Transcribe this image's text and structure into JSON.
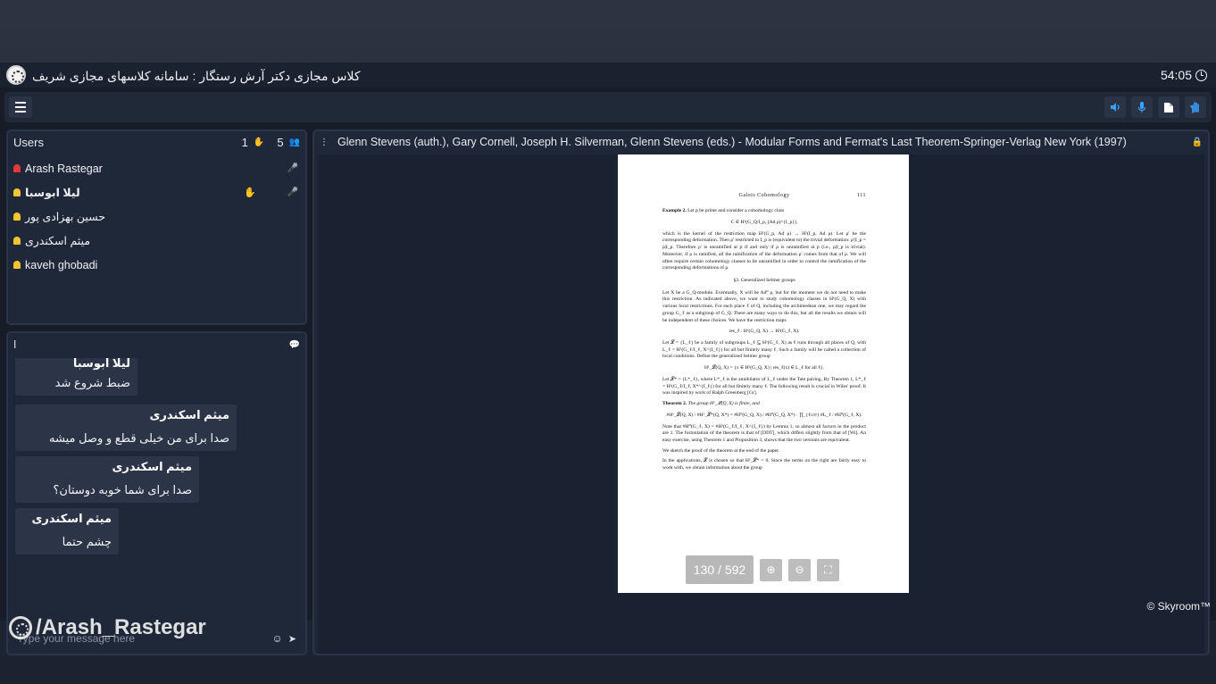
{
  "window": {
    "title": "کلاس مجازی دکتر آرش رستگار : سامانه کلاسهای مجازی شریف",
    "timer": "54:05"
  },
  "toolbar": {
    "menu_icon": "hamburger-icon",
    "buttons": [
      {
        "name": "speaker",
        "icon": "speaker-icon"
      },
      {
        "name": "microphone",
        "icon": "microphone-icon"
      },
      {
        "name": "file",
        "icon": "file-icon"
      },
      {
        "name": "raise-hand",
        "icon": "hand-icon"
      }
    ]
  },
  "users": {
    "header": "Users",
    "hands_count": "1",
    "users_count": "5",
    "list": [
      {
        "name": "Arash Rastegar",
        "role": "admin",
        "bold": false
      },
      {
        "name": "لیلا ابوسبا",
        "role": "user",
        "bold": true
      },
      {
        "name": "حسین بهزادی پور",
        "role": "user",
        "bold": false
      },
      {
        "name": "میثم اسکندری",
        "role": "user",
        "bold": false
      },
      {
        "name": "kaveh ghobadi",
        "role": "user",
        "bold": false
      }
    ]
  },
  "chat": {
    "header": "ا",
    "messages": [
      {
        "sender": "لیلا ابوسبا",
        "text": "ضبط شروع شد"
      },
      {
        "sender": "میثم اسکندری",
        "text": "صدا برای من خیلی قطع و وصل میشه"
      },
      {
        "sender": "میثم اسکندری",
        "text": "صدا برای شما خوبه دوستان؟"
      },
      {
        "sender": "میثم اسکندری",
        "text": "چشم حتما"
      }
    ],
    "input_placeholder": "Type your message here"
  },
  "watermark": "/Arash_Rastegar",
  "document": {
    "title": "Glenn Stevens (auth.), Gary Cornell, Joseph H. Silverman, Glenn Stevens (eds.) - Modular Forms and Fermat's Last Theorem-Springer-Verlag New York (1997)",
    "page_indicator": "130 / 592",
    "page": {
      "running_head": "Galois Cohomology",
      "page_number": "111",
      "example_label": "Example 2.",
      "example_text": "Let p be prime and consider a cohomology class",
      "eq1": "C ∈ H¹(G_Q/I_p, (Ad ρ)^{I_p}),",
      "para1": "which is the kernel of the restriction map H¹(G_p, Ad ρ) → H¹(I_p, Ad ρ). Let ρ' be the corresponding deformation. Then ρ' restricted to I_p is (equivalent to) the trivial deformation: ρ'|I_p = ρ|I_p. Therefore ρ' is unramified at p if and only if ρ is unramified at p (i.e., ρ|I_p is trivial). Moreover, if ρ is ramified, all the ramification of the deformation ρ' comes from that of ρ. We will often require certain cohomology classes to be unramified in order to control the ramification of the corresponding deformations of ρ.",
      "section": "§3. Generalized Selmer groups",
      "para2": "Let X be a G_Q-module. Eventually, X will be Ad⁰ ρ, but for the moment we do not need to make this restriction. As indicated above, we want to study cohomology classes in H¹(G_Q, X) with various local restrictions. For each place ℓ of Q, including the archimedean one, we may regard the group G_ℓ as a subgroup of G_Q. There are many ways to do this, but all the results we obtain will be independent of these choices. We have the restriction maps",
      "eq2": "res_ℓ : H¹(G_Q, X) → H¹(G_ℓ, X).",
      "para3": "Let 𝓛 = {L_ℓ} be a family of subgroups L_ℓ ⊆ H¹(G_ℓ, X) as ℓ runs through all places of Q, with L_ℓ = H¹(G_ℓ/I_ℓ, X^{I_ℓ}) for all but finitely many ℓ. Such a family will be called a collection of local conditions. Define the generalized Selmer group",
      "eq3": "H¹_𝓛(Q, X) = {x ∈ H¹(G_Q, X) | res_ℓ(x) ∈ L_ℓ for all ℓ}.",
      "para4": "Let 𝓛* = {L*_ℓ}, where L*_ℓ is the annihilator of L_ℓ under the Tate pairing. By Theorem 1, L*_ℓ = H¹(G_ℓ/I_ℓ, X*^{I_ℓ}) for all but finitely many ℓ. The following result is crucial in Wiles' proof. It was inspired by work of Ralph Greenberg [Gr].",
      "theorem_label": "Theorem 2.",
      "theorem_text": "The group H¹_𝓛(Q, X) is finite, and",
      "eq4": "#H¹_𝓛(Q, X) / #H¹_𝓛*(Q, X*) = #H⁰(G_Q, X) / #H⁰(G_Q, X*) · ∏_{ℓ≤∞} #L_ℓ / #H⁰(G_ℓ, X).",
      "para5": "Note that #H⁰(G_ℓ, X) = #H¹(G_ℓ/I_ℓ, X^{I_ℓ}) by Lemma 1, so almost all factors in the product are 1. The formulation of the theorem is that of [DDT], which differs slightly from that of [Wi]. An easy exercise, using Theorem 1 and Proposition 3, shows that the two versions are equivalent.",
      "para6": "We sketch the proof of the theorem at the end of the paper.",
      "para7": "In the applications, 𝓛 is chosen so that H¹_𝓛* = 0. Since the terms on the right are fairly easy to work with, we obtain information about the group"
    }
  },
  "footer": "© Skyroom™"
}
